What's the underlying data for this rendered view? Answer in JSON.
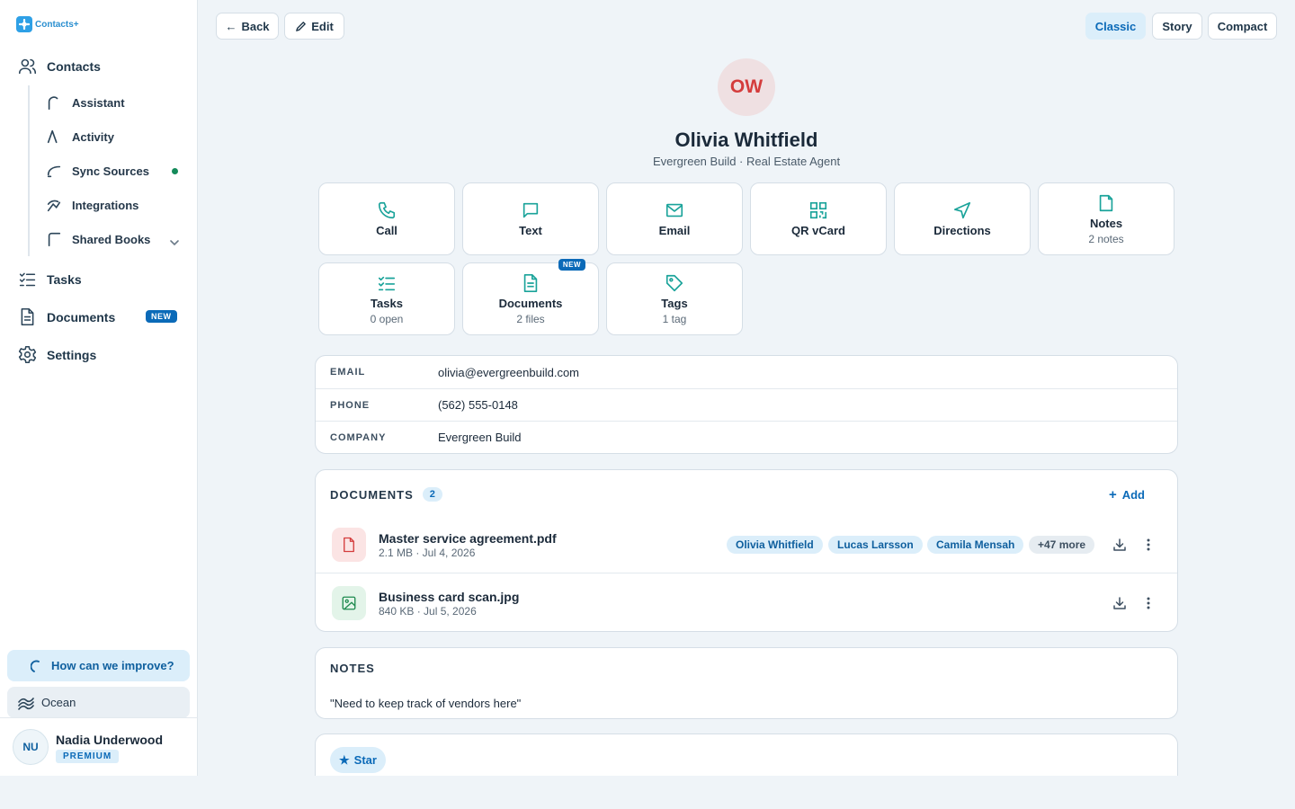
{
  "app": {
    "name": "Contacts+"
  },
  "sidebar": {
    "contacts_label": "Contacts",
    "sub_items": [
      {
        "label": "Assistant"
      },
      {
        "label": "Activity"
      },
      {
        "label": "Sync Sources"
      },
      {
        "label": "Integrations"
      },
      {
        "label": "Shared Books"
      }
    ],
    "tasks_label": "Tasks",
    "documents_label": "Documents",
    "documents_badge": "NEW",
    "settings_label": "Settings",
    "improve_label": "How can we improve?",
    "theme_label": "Ocean",
    "user": {
      "initials": "NU",
      "name": "Nadia Underwood",
      "plan": "PREMIUM"
    }
  },
  "toolbar": {
    "back_label": "Back",
    "edit_label": "Edit",
    "views": [
      "Classic",
      "Story",
      "Compact"
    ],
    "active_view": "Classic"
  },
  "contact": {
    "initials": "OW",
    "name": "Olivia Whitfield",
    "subtitle": "Evergreen Build · Real Estate Agent"
  },
  "actions": [
    {
      "label": "Call",
      "sub": ""
    },
    {
      "label": "Text",
      "sub": ""
    },
    {
      "label": "Email",
      "sub": ""
    },
    {
      "label": "QR vCard",
      "sub": ""
    },
    {
      "label": "Directions",
      "sub": ""
    },
    {
      "label": "Notes",
      "sub": "2 notes"
    },
    {
      "label": "Tasks",
      "sub": "0 open"
    },
    {
      "label": "Documents",
      "sub": "2 files",
      "badge": "NEW"
    },
    {
      "label": "Tags",
      "sub": "1 tag"
    }
  ],
  "info": [
    {
      "label": "EMAIL",
      "value": "olivia@evergreenbuild.com"
    },
    {
      "label": "PHONE",
      "value": "(562) 555-0148"
    },
    {
      "label": "COMPANY",
      "value": "Evergreen Build"
    }
  ],
  "documents": {
    "title": "DOCUMENTS",
    "count": "2",
    "add_label": "Add",
    "items": [
      {
        "name": "Master service agreement.pdf",
        "meta": "2.1 MB · Jul 4, 2026",
        "tags": [
          "Olivia Whitfield",
          "Lucas Larsson",
          "Camila Mensah"
        ],
        "more": "+47 more"
      },
      {
        "name": "Business card scan.jpg",
        "meta": "840 KB · Jul 5, 2026"
      }
    ]
  },
  "notes": {
    "title": "NOTES",
    "text": "\"Need to keep track of vendors here\""
  },
  "star_label": "Star",
  "colors": {
    "accent": "#0b6ab8",
    "teal_icon": "#1aa39a",
    "avatar_text": "#d43c3c",
    "status_dot": "#148a5a"
  }
}
